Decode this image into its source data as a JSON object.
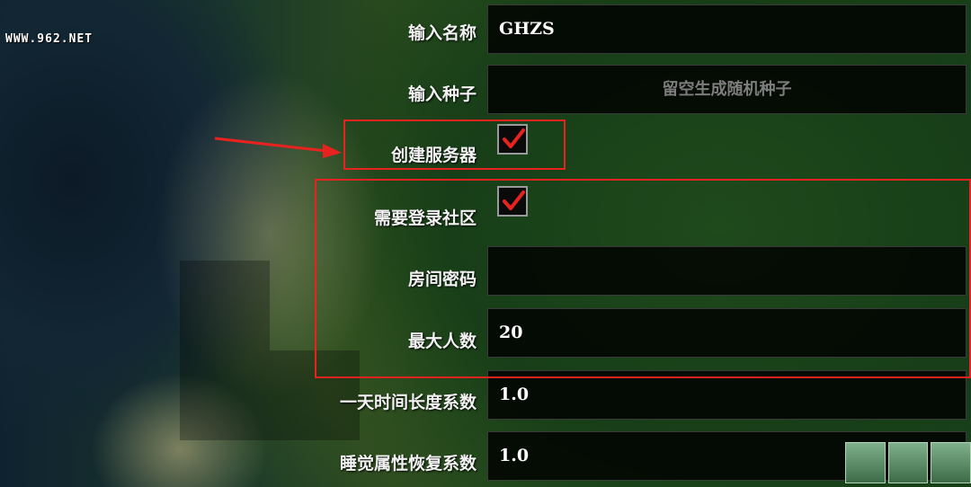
{
  "watermark": "WWW.962.NET",
  "form": {
    "name": {
      "label": "输入名称",
      "value": "GHZS"
    },
    "seed": {
      "label": "输入种子",
      "placeholder": "留空生成随机种子"
    },
    "create_server": {
      "label": "创建服务器",
      "checked": true
    },
    "require_login": {
      "label": "需要登录社区",
      "checked": true
    },
    "room_password": {
      "label": "房间密码",
      "value": ""
    },
    "max_players": {
      "label": "最大人数",
      "value": "20"
    },
    "day_length": {
      "label": "一天时间长度系数",
      "value": "1.0"
    },
    "sleep_recovery": {
      "label": "睡觉属性恢复系数",
      "value": "1.0"
    }
  },
  "colors": {
    "highlight": "#e8231f",
    "check": "#e8231f"
  }
}
